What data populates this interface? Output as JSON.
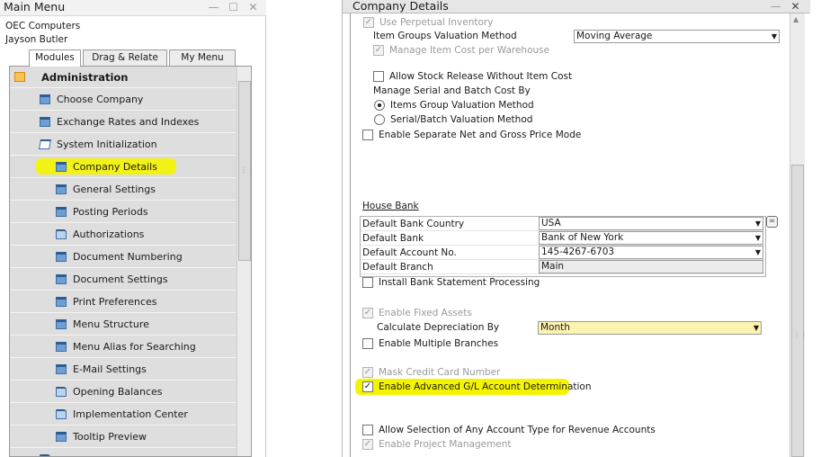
{
  "main_menu": {
    "title": "Main Menu",
    "company": "OEC Computers",
    "user": "Jayson Butler",
    "tabs": [
      {
        "label": "Modules",
        "active": true
      },
      {
        "label": "Drag & Relate",
        "active": false
      },
      {
        "label": "My Menu",
        "active": false
      }
    ],
    "items": [
      {
        "label": "Administration",
        "level": 0,
        "icon": "administration-icon"
      },
      {
        "label": "Choose Company",
        "level": 1,
        "icon": "form-icon"
      },
      {
        "label": "Exchange Rates and Indexes",
        "level": 1,
        "icon": "form-icon"
      },
      {
        "label": "System Initialization",
        "level": 1,
        "icon": "folder-open-icon"
      },
      {
        "label": "Company Details",
        "level": 2,
        "icon": "form-icon",
        "highlighted": true
      },
      {
        "label": "General Settings",
        "level": 2,
        "icon": "form-icon"
      },
      {
        "label": "Posting Periods",
        "level": 2,
        "icon": "form-icon"
      },
      {
        "label": "Authorizations",
        "level": 2,
        "icon": "folder-icon"
      },
      {
        "label": "Document Numbering",
        "level": 2,
        "icon": "form-icon"
      },
      {
        "label": "Document Settings",
        "level": 2,
        "icon": "form-icon"
      },
      {
        "label": "Print Preferences",
        "level": 2,
        "icon": "form-icon"
      },
      {
        "label": "Menu Structure",
        "level": 2,
        "icon": "form-icon"
      },
      {
        "label": "Menu Alias for Searching",
        "level": 2,
        "icon": "form-icon"
      },
      {
        "label": "E-Mail Settings",
        "level": 2,
        "icon": "form-icon"
      },
      {
        "label": "Opening Balances",
        "level": 2,
        "icon": "folder-icon"
      },
      {
        "label": "Implementation Center",
        "level": 2,
        "icon": "folder-icon"
      },
      {
        "label": "Tooltip Preview",
        "level": 2,
        "icon": "form-icon"
      }
    ]
  },
  "company_details": {
    "title": "Company Details",
    "use_perpetual_inventory": {
      "label": "Use Perpetual Inventory",
      "checked": true,
      "enabled": false
    },
    "item_groups_valuation": {
      "label": "Item Groups Valuation Method",
      "value": "Moving Average"
    },
    "manage_item_cost_per_warehouse": {
      "label": "Manage Item Cost per Warehouse",
      "checked": true,
      "enabled": false
    },
    "allow_stock_release": {
      "label": "Allow Stock Release Without Item Cost",
      "checked": false
    },
    "manage_serial_batch_label": "Manage Serial and Batch Cost By",
    "radio_items_group": {
      "label": "Items Group Valuation Method",
      "selected": true
    },
    "radio_serial_batch": {
      "label": "Serial/Batch Valuation Method",
      "selected": false
    },
    "separate_net_gross": {
      "label": "Enable Separate Net and Gross Price Mode",
      "checked": false
    },
    "house_bank": {
      "title": "House Bank",
      "rows": [
        {
          "label": "Default Bank Country",
          "value": "USA",
          "dropdown": true
        },
        {
          "label": "Default Bank",
          "value": "Bank of New York",
          "dropdown": true
        },
        {
          "label": "Default Account No.",
          "value": "145-4267-6703",
          "dropdown": true
        },
        {
          "label": "Default Branch",
          "value": "Main",
          "dropdown": false
        }
      ]
    },
    "install_bank_statement": {
      "label": "Install Bank Statement Processing",
      "checked": false
    },
    "enable_fixed_assets": {
      "label": "Enable Fixed Assets",
      "checked": true,
      "enabled": false
    },
    "calculate_depreciation": {
      "label": "Calculate Depreciation By",
      "value": "Month"
    },
    "multiple_branches": {
      "label": "Enable Multiple Branches",
      "checked": false
    },
    "mask_credit_card": {
      "label": "Mask Credit Card Number",
      "checked": true,
      "enabled": false
    },
    "advanced_gl": {
      "label": "Enable Advanced G/L Account Determination",
      "checked": true,
      "highlighted": true
    },
    "allow_any_account_type": {
      "label": "Allow Selection of Any Account Type for Revenue Accounts",
      "checked": false
    },
    "project_management": {
      "label": "Enable Project Management",
      "checked": true,
      "enabled": false
    }
  },
  "colors": {
    "highlight": "#f5f400",
    "menu_row": "#dedede",
    "yellow_field": "#fdf3b0"
  }
}
